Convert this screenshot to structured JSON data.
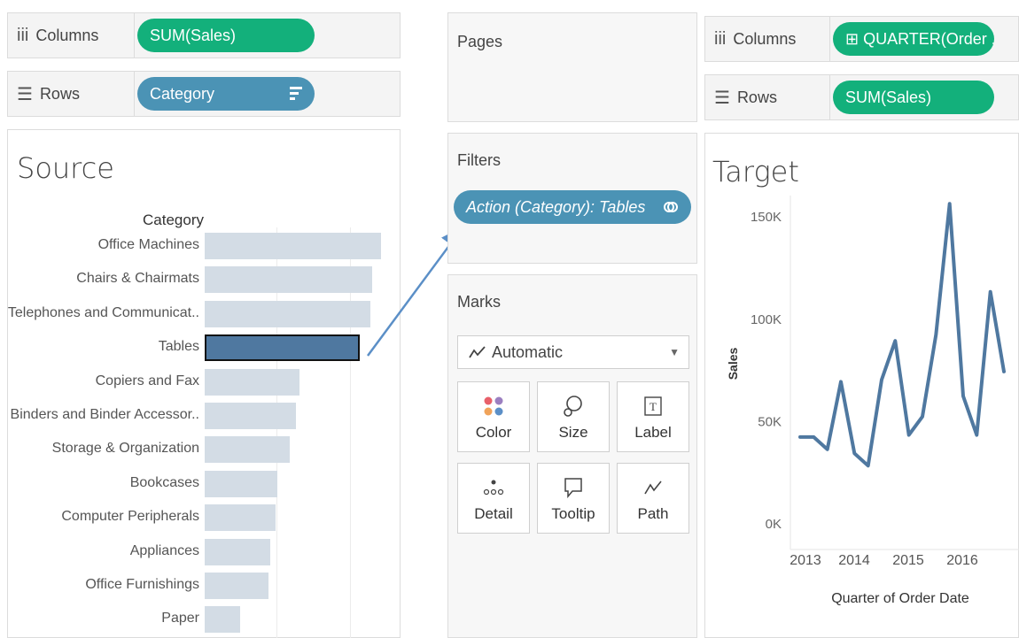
{
  "source_sheet": {
    "columns_shelf": {
      "label": "Columns",
      "pill": "SUM(Sales)"
    },
    "rows_shelf": {
      "label": "Rows",
      "pill": "Category"
    },
    "title": "Source",
    "category_header": "Category",
    "chart_data": {
      "type": "bar",
      "orientation": "horizontal",
      "categories": [
        "Office Machines",
        "Chairs & Chairmats",
        "Telephones and Communicat..",
        "Tables",
        "Copiers and Fax",
        "Binders and Binder Accessor..",
        "Storage & Organization",
        "Bookcases",
        "Computer Peripherals",
        "Appliances",
        "Office Furnishings",
        "Paper"
      ],
      "values": [
        100,
        95,
        94,
        88,
        54,
        52,
        48,
        41,
        40,
        37,
        36,
        20
      ],
      "selected": "Tables",
      "bar_color": "#d3dce5",
      "selected_color": "#4f78a0"
    }
  },
  "middle": {
    "pages": {
      "title": "Pages"
    },
    "filters": {
      "title": "Filters",
      "pill": "Action (Category): Tables"
    },
    "marks": {
      "title": "Marks",
      "mark_type": "Automatic",
      "buttons": [
        {
          "label": "Color",
          "icon": "color-dots-icon"
        },
        {
          "label": "Size",
          "icon": "size-icon"
        },
        {
          "label": "Label",
          "icon": "label-icon"
        },
        {
          "label": "Detail",
          "icon": "detail-icon"
        },
        {
          "label": "Tooltip",
          "icon": "tooltip-icon"
        },
        {
          "label": "Path",
          "icon": "path-icon"
        }
      ]
    }
  },
  "target_sheet": {
    "columns_shelf": {
      "label": "Columns",
      "pill": "⊞ QUARTER(Order .."
    },
    "rows_shelf": {
      "label": "Rows",
      "pill": "SUM(Sales)"
    },
    "title": "Target",
    "chart_data": {
      "type": "line",
      "title": "Target",
      "xlabel": "Quarter of Order Date",
      "ylabel": "Sales",
      "x_tick_labels": [
        "2013",
        "2014",
        "2015",
        "2016"
      ],
      "y_tick_labels": [
        "0K",
        "50K",
        "100K",
        "150K"
      ],
      "ylim": [
        0,
        160000
      ],
      "x": [
        "2013 Q1",
        "2013 Q2",
        "2013 Q3",
        "2013 Q4",
        "2014 Q1",
        "2014 Q2",
        "2014 Q3",
        "2014 Q4",
        "2015 Q1",
        "2015 Q2",
        "2015 Q3",
        "2015 Q4",
        "2016 Q1",
        "2016 Q2",
        "2016 Q3",
        "2016 Q4"
      ],
      "values": [
        42000,
        42000,
        36000,
        69000,
        34000,
        28000,
        70000,
        89000,
        43000,
        52000,
        92000,
        156000,
        62000,
        43000,
        113000,
        74000
      ],
      "line_color": "#4f78a0"
    }
  }
}
